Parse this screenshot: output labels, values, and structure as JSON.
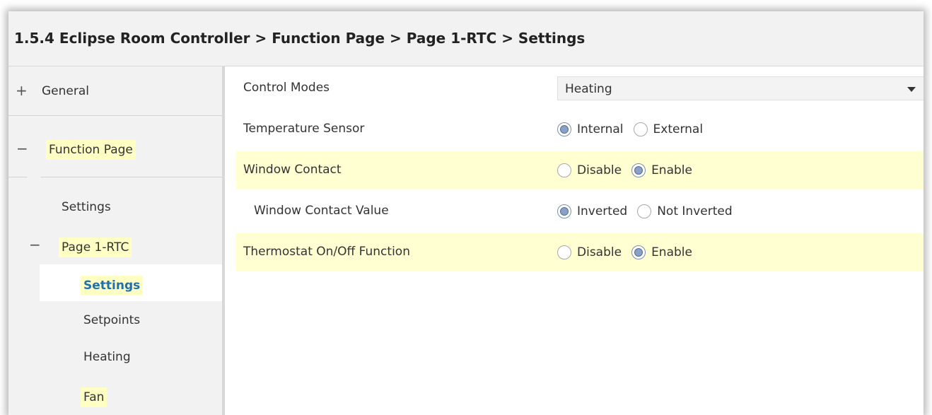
{
  "title": "1.5.4 Eclipse Room Controller > Function Page > Page 1-RTC > Settings",
  "sidebar": {
    "general": {
      "expander": "+",
      "label": "General"
    },
    "function_page": {
      "expander": "−",
      "label": "Function Page"
    },
    "settings": {
      "label": "Settings"
    },
    "page1": {
      "expander": "−",
      "label": "Page 1-RTC"
    },
    "page1_items": [
      {
        "label": "Settings"
      },
      {
        "label": "Setpoints"
      },
      {
        "label": "Heating"
      },
      {
        "label": "Fan"
      }
    ]
  },
  "params": {
    "control_modes": {
      "label": "Control Modes",
      "value": "Heating"
    },
    "temperature_sensor": {
      "label": "Temperature Sensor",
      "options": [
        "Internal",
        "External"
      ],
      "selected": "Internal"
    },
    "window_contact": {
      "label": "Window Contact",
      "options": [
        "Disable",
        "Enable"
      ],
      "selected": "Enable"
    },
    "window_contact_value": {
      "label": "Window Contact Value",
      "options": [
        "Inverted",
        "Not Inverted"
      ],
      "selected": "Inverted"
    },
    "thermostat": {
      "label": "Thermostat On/Off Function",
      "options": [
        "Disable",
        "Enable"
      ],
      "selected": "Enable"
    }
  },
  "colors": {
    "highlight": "#ffffc4",
    "selected_text": "#1f6fb5",
    "radio_fill": "#8ba0c6"
  }
}
